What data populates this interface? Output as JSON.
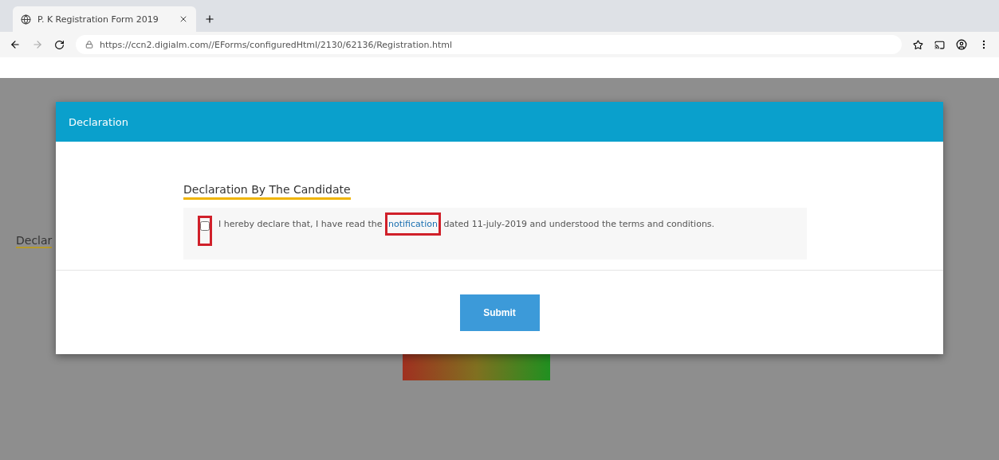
{
  "browser": {
    "tabs": [
      {
        "title": "P. K Registration Form 2019",
        "selected": true
      }
    ],
    "url": "https://ccn2.digialm.com//EForms/configuredHtml/2130/62136/Registration.html"
  },
  "background_page": {
    "heading": "Declar"
  },
  "modal": {
    "title": "Declaration",
    "heading": "Declaration By The Candidate",
    "declaration": {
      "checked": false,
      "before": "I hereby declare that, I have read the",
      "link": "notification",
      "after": "dated 11-july-2019 and understood the terms and conditions."
    },
    "buttons": [
      {
        "label": "Submit"
      }
    ]
  }
}
